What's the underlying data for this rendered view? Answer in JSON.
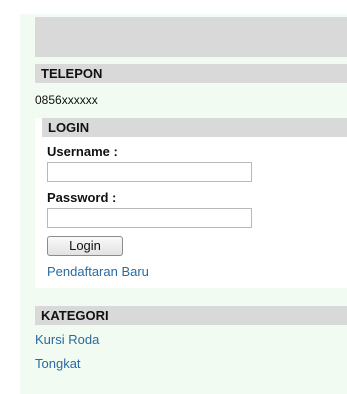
{
  "telepon": {
    "header": "TELEPON",
    "number": "0856xxxxxx"
  },
  "login": {
    "header": "LOGIN",
    "username_label": "Username :",
    "password_label": "Password :",
    "username_value": "",
    "password_value": "",
    "button_label": "Login",
    "register_link": "Pendaftaran Baru"
  },
  "kategori": {
    "header": "KATEGORI",
    "items": [
      "Kursi Roda",
      "Tongkat"
    ]
  }
}
